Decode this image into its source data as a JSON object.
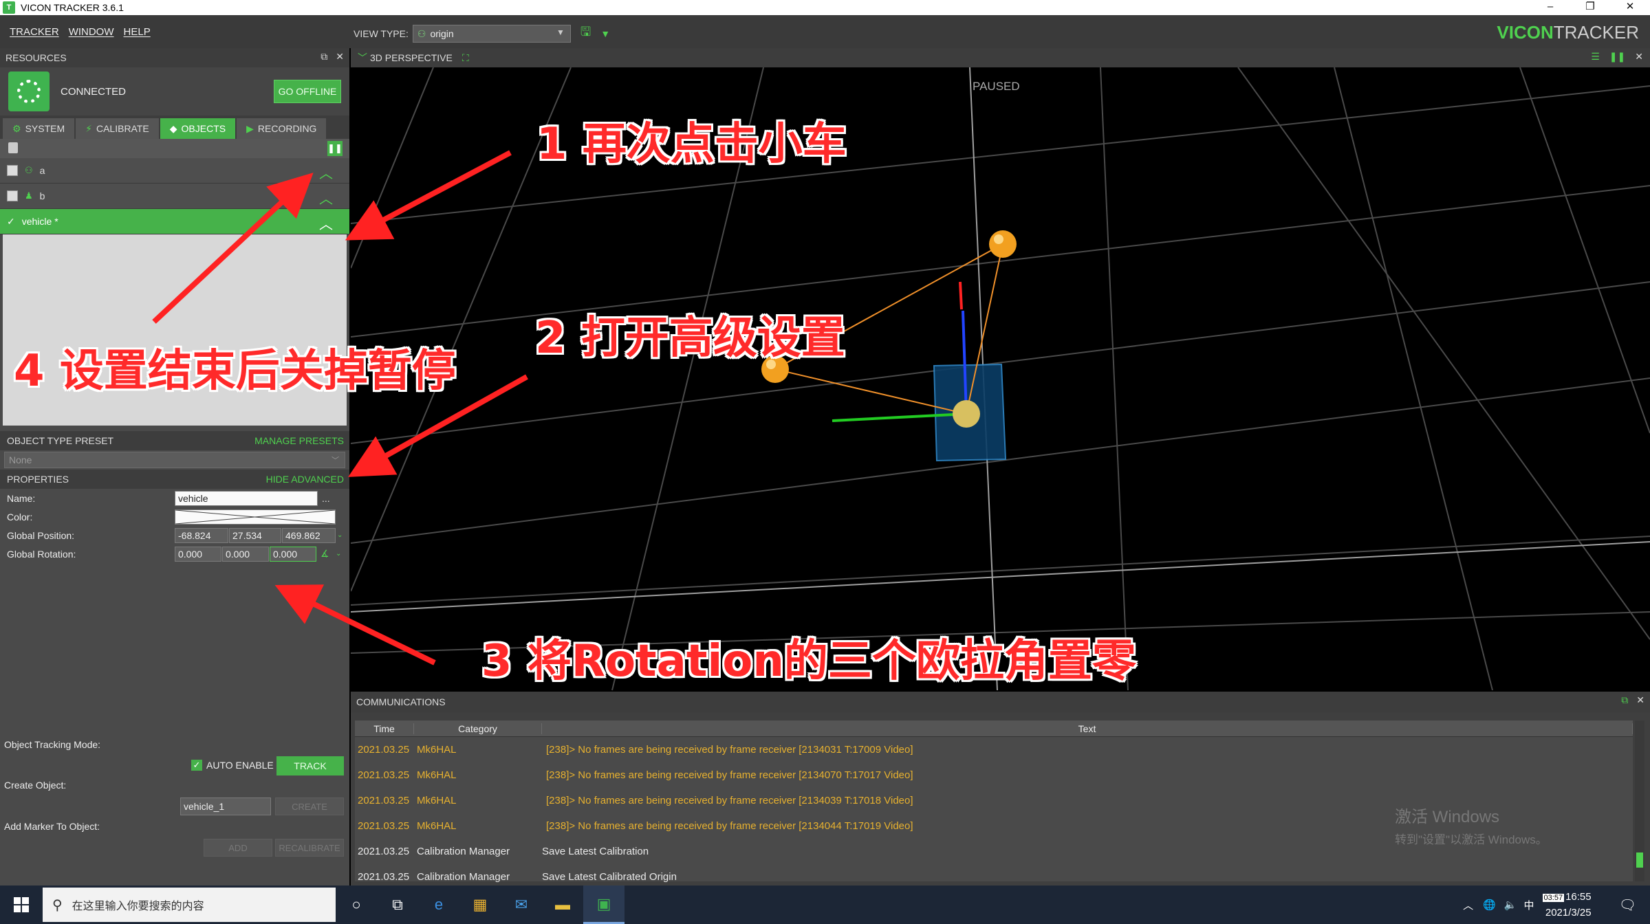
{
  "window": {
    "title": "VICON TRACKER 3.6.1",
    "controls": [
      "–",
      "❐",
      "✕"
    ]
  },
  "menu": {
    "items": [
      "TRACKER",
      "WINDOW",
      "HELP"
    ],
    "view_type_label": "VIEW TYPE:",
    "view_type_value": "origin"
  },
  "brand": {
    "part1": "VICON",
    "part2": "TRACKER"
  },
  "resources": {
    "title": "RESOURCES",
    "status": "CONNECTED",
    "go_offline": "GO OFFLINE"
  },
  "tabs": [
    {
      "label": "SYSTEM",
      "icon": "gear-icon"
    },
    {
      "label": "CALIBRATE",
      "icon": "wand-icon"
    },
    {
      "label": "OBJECTS",
      "icon": "diamond-icon"
    },
    {
      "label": "RECORDING",
      "icon": "camera-icon"
    }
  ],
  "objects": {
    "rows": [
      {
        "name": "a",
        "checked": false
      },
      {
        "name": "b",
        "checked": false
      },
      {
        "name": "vehicle *",
        "checked": true
      }
    ]
  },
  "preset": {
    "title": "OBJECT TYPE PRESET",
    "manage": "MANAGE PRESETS",
    "value": "None"
  },
  "properties": {
    "title": "PROPERTIES",
    "hide_advanced": "HIDE ADVANCED",
    "name_label": "Name:",
    "name_value": "vehicle",
    "name_more": "...",
    "color_label": "Color:",
    "position_label": "Global Position:",
    "position": [
      "-68.824",
      "27.534",
      "469.862"
    ],
    "rotation_label": "Global Rotation:",
    "rotation": [
      "0.000",
      "0.000",
      "0.000"
    ]
  },
  "lower": {
    "tracking_mode_label": "Object Tracking Mode:",
    "auto_enable": "AUTO ENABLE",
    "track": "TRACK",
    "create_object_label": "Create Object:",
    "create_value": "vehicle_1",
    "create_btn": "CREATE",
    "add_marker_label": "Add Marker To Object:",
    "add_btn": "ADD",
    "recalibrate_btn": "RECALIBRATE"
  },
  "viewport": {
    "title": "3D PERSPECTIVE",
    "status": "PAUSED"
  },
  "comms": {
    "title": "COMMUNICATIONS",
    "columns": [
      "Time",
      "Category",
      "Text"
    ],
    "rows": [
      {
        "time": "2021.03.25",
        "category": "Mk6HAL",
        "text": "[238]> No frames are being received by frame receiver [2134031 T:17009 Video]",
        "level": "warn"
      },
      {
        "time": "2021.03.25",
        "category": "Mk6HAL",
        "text": "[238]> No frames are being received by frame receiver [2134070 T:17017 Video]",
        "level": "warn"
      },
      {
        "time": "2021.03.25",
        "category": "Mk6HAL",
        "text": "[238]> No frames are being received by frame receiver [2134039 T:17018 Video]",
        "level": "warn"
      },
      {
        "time": "2021.03.25",
        "category": "Mk6HAL",
        "text": "[238]> No frames are being received by frame receiver [2134044 T:17019 Video]",
        "level": "warn"
      },
      {
        "time": "2021.03.25",
        "category": "Calibration Manager",
        "text": "Save Latest Calibration",
        "level": "info"
      },
      {
        "time": "2021.03.25",
        "category": "Calibration Manager",
        "text": "Save Latest Calibrated Origin",
        "level": "info"
      }
    ]
  },
  "watermark": {
    "line1": "激活 Windows",
    "line2": "转到\"设置\"以激活 Windows。"
  },
  "taskbar": {
    "search_placeholder": "在这里输入你要搜索的内容",
    "ime": "中",
    "time": "16:55",
    "date": "2021/3/25",
    "badge": "03:57"
  },
  "annotations": {
    "a1": "1 再次点击小车",
    "a2": "2 打开高级设置",
    "a3": "3 将Rotation的三个欧拉角置零",
    "a4": "4 设置结束后关掉暂停"
  },
  "colors": {
    "accent_green": "#46b24a",
    "warn_text": "#e7b12f",
    "annotation_red": "#ff2a2a"
  }
}
